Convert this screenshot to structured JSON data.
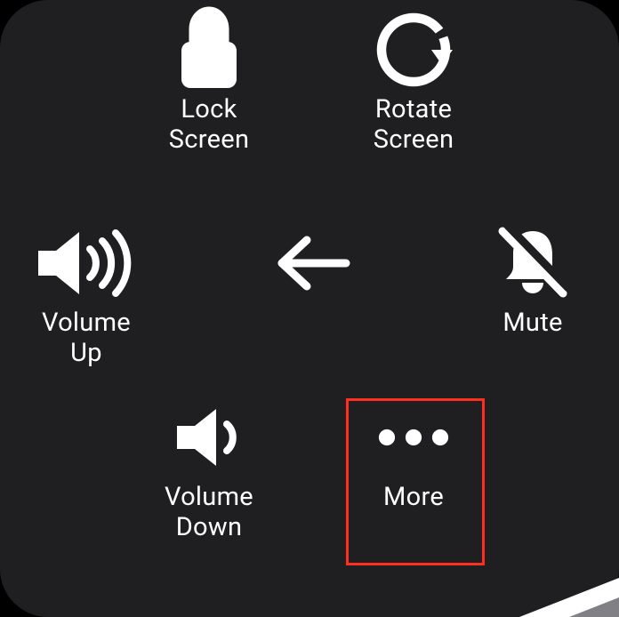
{
  "menu": {
    "lock": {
      "label": "Lock\nScreen"
    },
    "rotate": {
      "label": "Rotate\nScreen"
    },
    "volumeUp": {
      "label": "Volume\nUp"
    },
    "back": {
      "label": ""
    },
    "mute": {
      "label": "Mute"
    },
    "volumeDown": {
      "label": "Volume\nDown"
    },
    "more": {
      "label": "More"
    }
  },
  "highlighted": "more"
}
